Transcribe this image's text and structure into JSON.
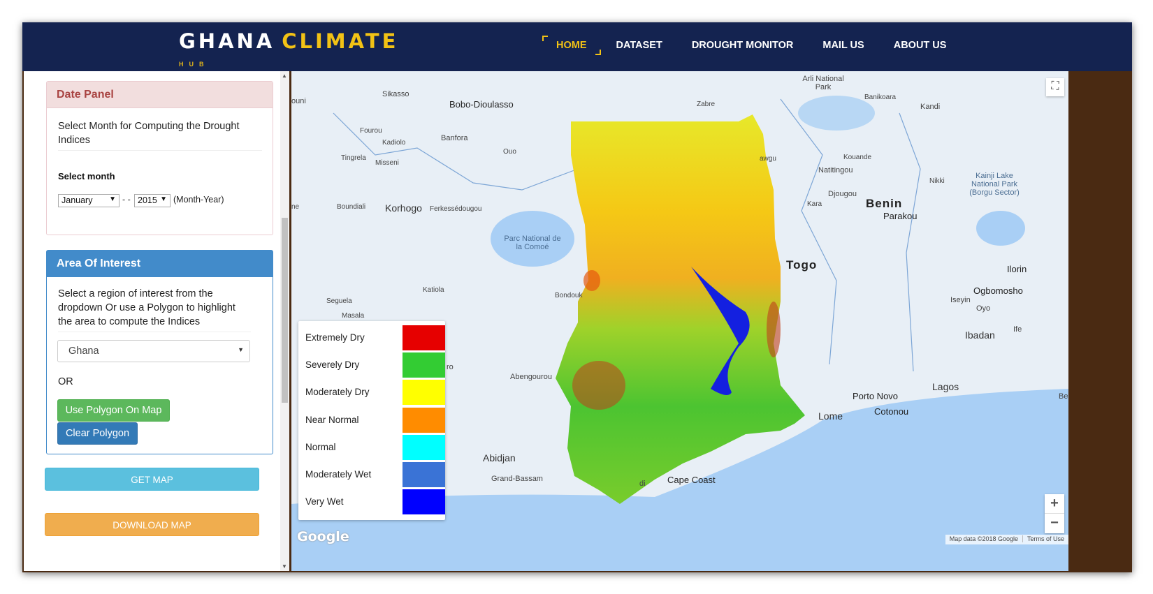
{
  "brand": {
    "word1": "GHANA",
    "word2": "CLIMATE",
    "sub": "HUB"
  },
  "nav": [
    {
      "label": "HOME",
      "active": true
    },
    {
      "label": "DATASET"
    },
    {
      "label": "DROUGHT MONITOR"
    },
    {
      "label": "MAIL US"
    },
    {
      "label": "ABOUT US"
    }
  ],
  "date_panel": {
    "title": "Date Panel",
    "text": "Select Month for Computing the Drought Indices",
    "select_label": "Select month",
    "month_value": "January",
    "dash": "- -",
    "year_value": "2015",
    "month_year": "(Month-Year)"
  },
  "aoi_panel": {
    "title": "Area Of Interest",
    "text": "Select a region of interest from the dropdown Or use a Polygon to highlight the area to compute the Indices",
    "region_value": "Ghana",
    "or_label": "OR",
    "polygon_btn": "Use Polygon On Map",
    "clear_btn": "Clear Polygon"
  },
  "actions": {
    "get_map": "GET MAP",
    "download_map": "DOWNLOAD MAP"
  },
  "legend": [
    {
      "label": "Extremely Dry",
      "color": "#e60000"
    },
    {
      "label": "Severely Dry",
      "color": "#33cc33"
    },
    {
      "label": "Moderately Dry",
      "color": "#ffff00"
    },
    {
      "label": "Near Normal",
      "color": "#ff8c00"
    },
    {
      "label": "Normal",
      "color": "#00ffff"
    },
    {
      "label": "Moderately Wet",
      "color": "#3a73d6"
    },
    {
      "label": "Very Wet",
      "color": "#0000ff"
    }
  ],
  "map_labels": {
    "sikasso": "Sikasso",
    "bobo": "Bobo-Dioulasso",
    "fourou": "Fourou",
    "kadiolo": "Kadiolo",
    "banfora": "Banfora",
    "ouo": "Ouo",
    "tingrela": "Tingrela",
    "misseni": "Misseni",
    "korhogo": "Korhogo",
    "ferke": "Ferkessédougou",
    "boundiali": "Boundiali",
    "comoe": "Parc National de la Comoé",
    "katiola": "Katiola",
    "seguela": "Seguela",
    "masala": "Masala",
    "bondouk": "Bondouk",
    "abengourou": "Abengourou",
    "abidjan": "Abidjan",
    "grand_bassam": "Grand-Bassam",
    "cape_coast": "Cape Coast",
    "arli": "Arli National Park",
    "zabre": "Zabre",
    "banikoara": "Banikoara",
    "kandi": "Kandi",
    "kouande": "Kouande",
    "natitingou": "Natitingou",
    "nikki": "Nikki",
    "kainji": "Kainji Lake National Park (Borgu Sector)",
    "djougou": "Djougou",
    "kara": "Kara",
    "benin": "Benin",
    "parakou": "Parakou",
    "togo": "Togo",
    "ilorin": "Ilorin",
    "ogbomosho": "Ogbomosho",
    "iseyin": "Iseyin",
    "oyo": "Oyo",
    "ibadan": "Ibadan",
    "ife": "Ife",
    "porto_novo": "Porto Novo",
    "cotonou": "Cotonou",
    "lagos": "Lagos",
    "lome": "Lome",
    "ouni": "ouni",
    "ne": "ne",
    "ro": "ro",
    "di": "di",
    "be": "Be",
    "lawgu": "awgu"
  },
  "map_ui": {
    "google": "Google",
    "attribution": "Map data ©2018 Google",
    "terms": "Terms of Use",
    "zoom_in": "+",
    "zoom_out": "−",
    "fullscreen": "⛶"
  }
}
